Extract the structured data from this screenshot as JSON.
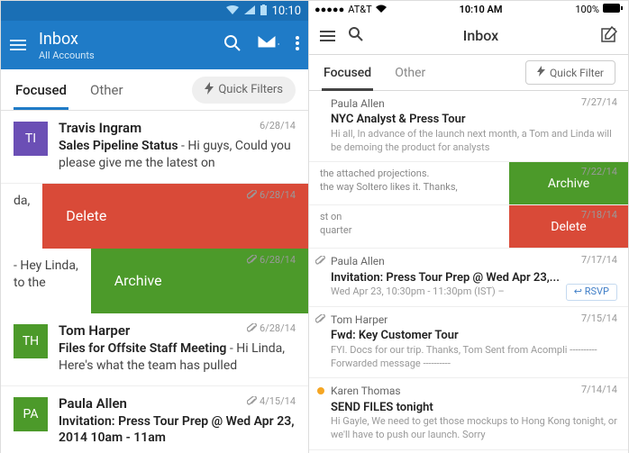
{
  "android": {
    "status": {
      "time": "10:10"
    },
    "header": {
      "title": "Inbox",
      "subtitle": "All Accounts"
    },
    "tabs": {
      "focused": "Focused",
      "other": "Other",
      "quick_filters": "Quick Filters"
    },
    "items": [
      {
        "avatar": "TI",
        "avatar_color": "#6b4fb5",
        "from": "Travis Ingram",
        "date": "6/28/14",
        "subject": "Sales Pipeline Status",
        "snippet": " - Hi guys, Could you please give me the latest on"
      },
      {
        "type": "swipe",
        "label": "Delete",
        "color": "red",
        "snippet": "da,",
        "date": "6/28/14",
        "has_attach": true
      },
      {
        "type": "swipe",
        "label": "Archive",
        "color": "green",
        "snippet": "- Hey Linda,\nto the",
        "date": "6/28/14",
        "has_attach": true
      },
      {
        "avatar": "TH",
        "avatar_color": "#4c9a2a",
        "from": "Tom Harper",
        "date": "6/28/14",
        "has_attach": true,
        "subject": "Files for Offsite Staff Meeting",
        "snippet": " - Hi Linda, Here's what the team has pulled"
      },
      {
        "avatar": "PA",
        "avatar_color": "#4c9a2a",
        "from": "Paula Allen",
        "date": "4/15/14",
        "has_attach": true,
        "subject": "Invitation: Press Tour Prep @ Wed Apr 23, 2014 10am - 11am",
        "snippet": ""
      }
    ]
  },
  "ios": {
    "status": {
      "carrier": "AT&T",
      "time": "10:10 AM",
      "battery": "100%"
    },
    "header": {
      "title": "Inbox"
    },
    "tabs": {
      "focused": "Focused",
      "other": "Other",
      "quick_filter": "Quick Filter"
    },
    "items": [
      {
        "from": "Paula Allen",
        "subject": "NYC Analyst & Press Tour",
        "snippet": "Hi all, In advance of the launch next month, a Tom and Linda will be demoing the product for analysts",
        "date": "7/27/14"
      },
      {
        "type": "swipe",
        "label": "Archive",
        "color": "green",
        "snippet": "the attached projections.\nthe way Soltero likes it. Thanks,",
        "date": "7/22/14"
      },
      {
        "type": "swipe",
        "label": "Delete",
        "color": "red",
        "snippet": "st on\nquarter",
        "date": "7/18/14"
      },
      {
        "has_attach": true,
        "from": "Paula Allen",
        "subject": "Invitation: Press Tour Prep @ Wed Apr 23,...",
        "snippet": "Wed Apr 23, 10:30pm - 11:30pm (IST) –",
        "date": "7/17/14",
        "rsvp": "RSVP"
      },
      {
        "has_attach": true,
        "from": "Tom Harper",
        "subject": "Fwd: Key Customer Tour",
        "snippet": "FYI. Docs for our trip. Thanks, Tom Sent from Acompli ---------- Forwarded message ----------",
        "date": "7/15/14"
      },
      {
        "dot": "#f5a623",
        "from": "Karen Thomas",
        "subject": "SEND FILES tonight",
        "snippet": "Hi Gayle, We need to get those mockups to Hong Kong tonight, or we'll have to push our launch. Sorry",
        "date": "7/14/14"
      }
    ]
  }
}
